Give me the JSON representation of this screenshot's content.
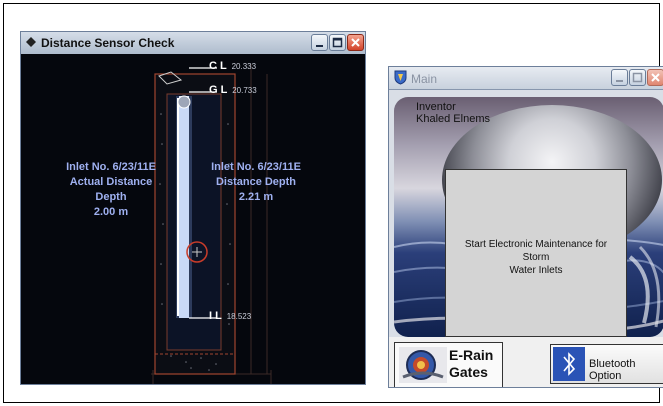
{
  "distance_window": {
    "title": "Distance Sensor Check",
    "left_label": {
      "line1": "Inlet No. 6/23/11E",
      "line2": "Actual Distance Depth",
      "line3": "2.00 m"
    },
    "right_label": {
      "line1": "Inlet No. 6/23/11E",
      "line2": "Distance Depth",
      "line3": "2.21 m"
    },
    "levels": [
      {
        "code": "C L",
        "value": "20.333"
      },
      {
        "code": "G L",
        "value": "20.733"
      },
      {
        "code": "I L",
        "value": "18.523"
      }
    ]
  },
  "main_window": {
    "title": "Main",
    "credit_line1": "Inventor",
    "credit_line2": "Khaled Elnems",
    "message_line1": "Start Electronic Maintenance for Storm",
    "message_line2": "Water Inlets",
    "logo_line1": "E-Rain",
    "logo_line2": "Gates",
    "bluetooth_label": "Bluetooth Option"
  }
}
